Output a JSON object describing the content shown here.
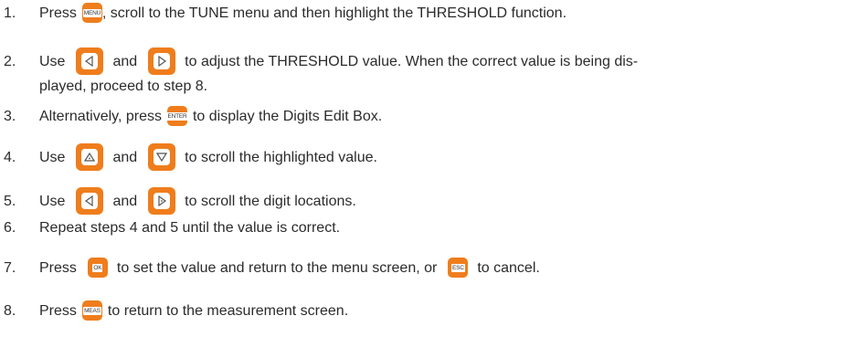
{
  "steps": [
    {
      "num": "1.",
      "a": "Press",
      "b": ", scroll to the TUNE menu and then highlight the THRESHOLD function.",
      "key": "MENU"
    },
    {
      "num": "2.",
      "a": "Use",
      "b": "and",
      "c": "to adjust the THRESHOLD value. When the correct value is being dis-",
      "d": "played, proceed to step 8."
    },
    {
      "num": "3.",
      "a": "Alternatively, press",
      "b": "to display the Digits Edit Box.",
      "key": "ENTER"
    },
    {
      "num": "4.",
      "a": "Use",
      "b": "and",
      "c": "to scroll the highlighted value."
    },
    {
      "num": "5.",
      "a": "Use",
      "b": "and",
      "c": "to scroll the digit locations."
    },
    {
      "num": "6.",
      "a": "Repeat steps 4 and 5 until the value is correct."
    },
    {
      "num": "7.",
      "a": "Press",
      "b": "to set the value and return to the menu screen, or",
      "c": "to cancel.",
      "key": "OK",
      "key2": "ESC"
    },
    {
      "num": "8.",
      "a": "Press",
      "b": "to return to the measurement screen.",
      "key": "MEAS"
    }
  ],
  "icons": {
    "left": "left-arrow-icon",
    "right": "right-arrow-icon",
    "up": "up-arrow-icon",
    "down": "down-arrow-icon"
  },
  "colors": {
    "key_orange": "#ef7d1c",
    "text": "#2b2b2b"
  }
}
